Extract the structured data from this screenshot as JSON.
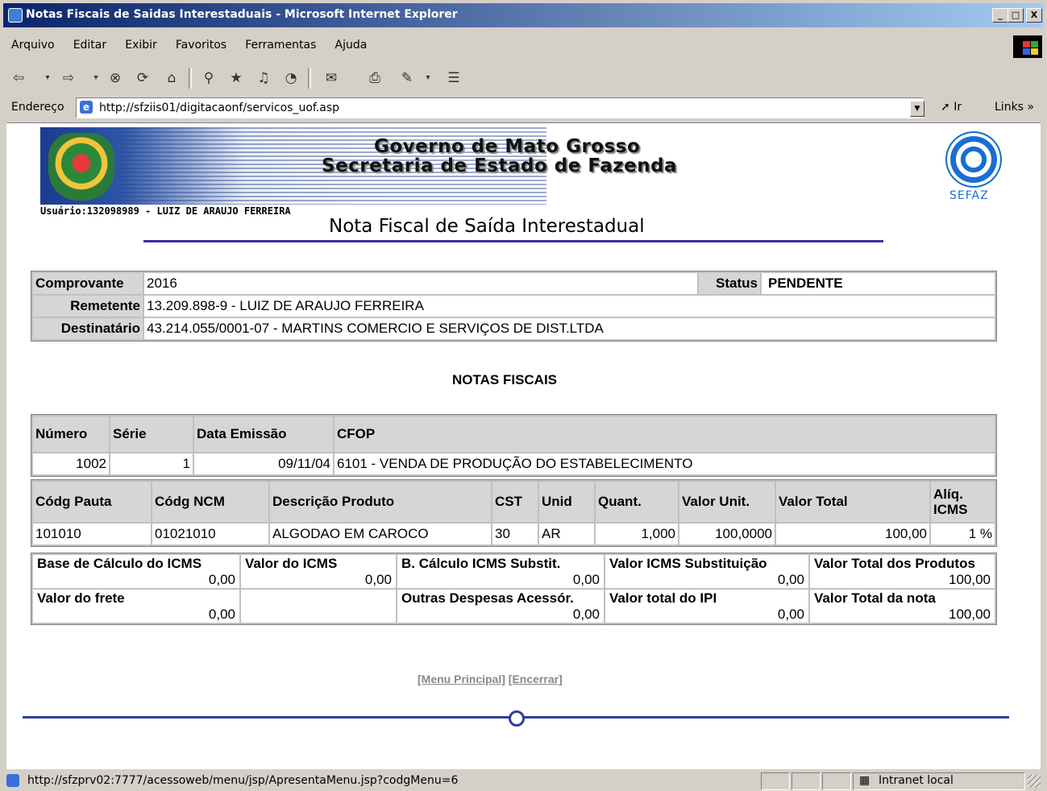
{
  "window": {
    "title": "Notas Fiscais de Saidas Interestaduais - Microsoft Internet Explorer",
    "minimize": "_",
    "maximize": "□",
    "close": "X"
  },
  "menu": [
    "Arquivo",
    "Editar",
    "Exibir",
    "Favoritos",
    "Ferramentas",
    "Ajuda"
  ],
  "toolbar": {
    "icons": [
      "back-icon",
      "forward-icon",
      "stop-icon",
      "refresh-icon",
      "home-icon",
      "search-icon",
      "favorites-icon",
      "media-icon",
      "history-icon",
      "mail-icon",
      "print-icon",
      "edit-icon",
      "discuss-icon"
    ]
  },
  "address": {
    "label": "Endereço",
    "url": "http://sfziis01/digitacaonf/servicos_uof.asp",
    "go": "Ir",
    "links": "Links »"
  },
  "header": {
    "gov_line1": "Governo de Mato Grosso",
    "gov_line2": "Secretaria de Estado de Fazenda",
    "logo_text": "SEFAZ",
    "usuario": "Usuário:132098989 - LUIZ DE ARAUJO FERREIRA",
    "page_title": "Nota Fiscal de Saída Interestadual"
  },
  "comprovante": {
    "label_comprovante": "Comprovante",
    "comprovante": "2016",
    "label_status": "Status",
    "status": "PENDENTE",
    "label_remetente": "Remetente",
    "remetente": "13.209.898-9 - LUIZ DE ARAUJO FERREIRA",
    "label_destinatario": "Destinatário",
    "destinatario": "43.214.055/0001-07 - MARTINS COMERCIO E SERVIÇOS DE DIST.LTDA"
  },
  "notas": {
    "section_title": "NOTAS FISCAIS",
    "headers": [
      "Número",
      "Série",
      "Data Emissão",
      "CFOP"
    ],
    "row": [
      "1002",
      "1",
      "09/11/04",
      "6101 - VENDA DE PRODUÇÃO DO ESTABELECIMENTO"
    ]
  },
  "produtos": {
    "headers": [
      "Códg Pauta",
      "Códg NCM",
      "Descrição Produto",
      "CST",
      "Unid",
      "Quant.",
      "Valor Unit.",
      "Valor Total",
      "Alíq. ICMS"
    ],
    "row": [
      "101010",
      "01021010",
      "ALGODAO EM CAROCO",
      "30",
      "AR",
      "1,000",
      "100,0000",
      "100,00",
      "1 %"
    ]
  },
  "totais": {
    "base_icms_label": "Base de Cálculo do ICMS",
    "base_icms": "0,00",
    "valor_icms_label": "Valor do ICMS",
    "valor_icms": "0,00",
    "base_subst_label": "B. Cálculo ICMS Substit.",
    "base_subst": "0,00",
    "valor_subst_label": "Valor ICMS Substituição",
    "valor_subst": "0,00",
    "total_produtos_label": "Valor Total dos Produtos",
    "total_produtos": "100,00",
    "frete_label": "Valor do frete",
    "frete": "0,00",
    "outras_label": "Outras Despesas Acessór.",
    "outras": "0,00",
    "ipi_label": "Valor total do IPI",
    "ipi": "0,00",
    "total_nota_label": "Valor Total da nota",
    "total_nota": "100,00"
  },
  "footer_links": {
    "menu_principal": "[Menu Principal]",
    "encerrar": "[Encerrar]"
  },
  "statusbar": {
    "text": "http://sfzprv02:7777/acessoweb/menu/jsp/ApresentaMenu.jsp?codgMenu=6",
    "zone": "Intranet local"
  }
}
